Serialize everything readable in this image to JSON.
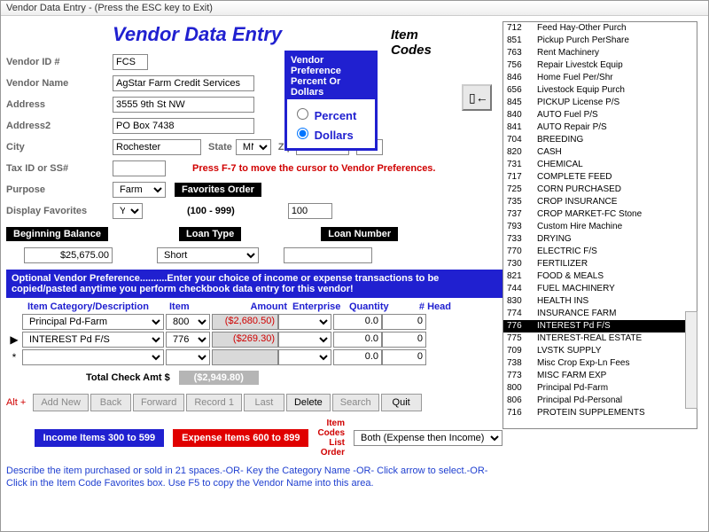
{
  "titlebar": "Vendor Data Entry - (Press the ESC key to Exit)",
  "heading": "Vendor Data Entry",
  "item_codes_header": "Item Codes",
  "labels": {
    "vendor_id": "Vendor ID #",
    "vendor_name": "Vendor Name",
    "address": "Address",
    "address2": "Address2",
    "city": "City",
    "state": "State",
    "zip": "Zip",
    "tax_id": "Tax ID or SS#",
    "purpose": "Purpose",
    "display_favs": "Display Favorites",
    "favs_order": "Favorites Order",
    "favs_range": "(100 - 999)",
    "beg_balance": "Beginning Balance",
    "loan_type": "Loan Type",
    "loan_number": "Loan Number"
  },
  "vendor": {
    "id": "FCS",
    "name": "AgStar Farm Credit Services",
    "address": "3555 9th St NW",
    "address2": "PO Box 7438",
    "city": "Rochester",
    "state": "MN",
    "zip": "55903",
    "zip_suffix": "",
    "tax_id": "",
    "purpose": "Farm",
    "display_favorites": "Y",
    "favorites_order": "100",
    "beginning_balance": "$25,675.00",
    "loan_type": "Short",
    "loan_number": ""
  },
  "pref": {
    "header": "Vendor Preference Percent Or Dollars",
    "opt_percent": "Percent",
    "opt_dollars": "Dollars",
    "selected": "Dollars"
  },
  "hint_f7": "Press F-7 to move the cursor to Vendor Preferences.",
  "bluebar": "Optional Vendor Preference..........Enter your choice of income or expense transactions to be copied/pasted anytime you perform checkbook data entry for this vendor!",
  "table": {
    "headers": {
      "cat": "Item Category/Description",
      "item": "Item",
      "amount": "Amount",
      "enterprise": "Enterprise",
      "quantity": "Quantity",
      "head": "# Head"
    },
    "rows": [
      {
        "marker": "",
        "cat": "Principal Pd-Farm",
        "item": "800",
        "amount": "($2,680.50)",
        "enterprise": "",
        "quantity": "0.0",
        "head": "0"
      },
      {
        "marker": "▶",
        "cat": "INTEREST Pd F/S",
        "item": "776",
        "amount": "($269.30)",
        "enterprise": "",
        "quantity": "0.0",
        "head": "0"
      },
      {
        "marker": "*",
        "cat": "",
        "item": "",
        "amount": "",
        "enterprise": "",
        "quantity": "0.0",
        "head": "0"
      }
    ],
    "total_label": "Total Check Amt $",
    "total_value": "($2,949.80)"
  },
  "nav": {
    "alt": "Alt +",
    "add_new": "Add New",
    "back": "Back",
    "forward": "Forward",
    "record1": "Record 1",
    "last": "Last",
    "delete": "Delete",
    "search": "Search",
    "quit": "Quit"
  },
  "footer": {
    "income": "Income Items 300 to 599",
    "expense": "Expense Items 600 to 899",
    "list_order_label": "Item Codes List Order",
    "list_order_value": "Both (Expense then Income)"
  },
  "description": "Describe the item purchased or sold in 21 spaces.-OR- Key the Category Name -OR- Click arrow to select.-OR- Click in the Item Code Favorites box. Use F5 to copy the Vendor Name into this area.",
  "right_btn": "▯←",
  "codes": [
    {
      "n": "712",
      "t": "Feed Hay-Other Purch"
    },
    {
      "n": "851",
      "t": "Pickup Purch PerShare"
    },
    {
      "n": "763",
      "t": "Rent Machinery"
    },
    {
      "n": "756",
      "t": "Repair Livestck Equip"
    },
    {
      "n": "846",
      "t": "Home Fuel Per/Shr"
    },
    {
      "n": "656",
      "t": "Livestock Equip Purch"
    },
    {
      "n": "845",
      "t": "PICKUP License P/S"
    },
    {
      "n": "840",
      "t": "AUTO Fuel P/S"
    },
    {
      "n": "841",
      "t": "AUTO Repair P/S"
    },
    {
      "n": "704",
      "t": "BREEDING"
    },
    {
      "n": "820",
      "t": "CASH"
    },
    {
      "n": "731",
      "t": "CHEMICAL"
    },
    {
      "n": "717",
      "t": "COMPLETE FEED"
    },
    {
      "n": "725",
      "t": "CORN PURCHASED"
    },
    {
      "n": "735",
      "t": "CROP INSURANCE"
    },
    {
      "n": "737",
      "t": "CROP MARKET-FC Stone"
    },
    {
      "n": "793",
      "t": "Custom Hire Machine"
    },
    {
      "n": "733",
      "t": "DRYING"
    },
    {
      "n": "770",
      "t": "ELECTRIC F/S"
    },
    {
      "n": "730",
      "t": "FERTILIZER"
    },
    {
      "n": "821",
      "t": "FOOD & MEALS"
    },
    {
      "n": "744",
      "t": "FUEL MACHINERY"
    },
    {
      "n": "830",
      "t": "HEALTH INS"
    },
    {
      "n": "774",
      "t": "INSURANCE FARM"
    },
    {
      "n": "776",
      "t": "INTEREST Pd F/S",
      "sel": true
    },
    {
      "n": "775",
      "t": "INTEREST-REAL ESTATE"
    },
    {
      "n": "709",
      "t": "LVSTK SUPPLY"
    },
    {
      "n": "738",
      "t": "Misc Crop Exp-Ln Fees"
    },
    {
      "n": "773",
      "t": "MISC FARM EXP"
    },
    {
      "n": "800",
      "t": "Principal Pd-Farm"
    },
    {
      "n": "806",
      "t": "Principal Pd-Personal"
    },
    {
      "n": "716",
      "t": "PROTEIN SUPPLEMENTS"
    }
  ]
}
